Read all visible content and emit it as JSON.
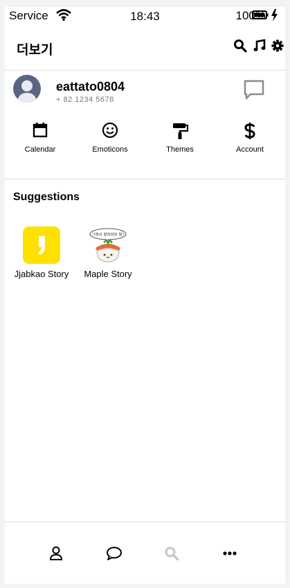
{
  "status_bar": {
    "carrier": "Service",
    "time": "18:43",
    "battery": "100%"
  },
  "header": {
    "title": "더보기"
  },
  "profile": {
    "username": "eattato0804",
    "phone": "+ 82 1234 5678"
  },
  "quick_menu": [
    {
      "label": "Calendar",
      "icon": "calendar-icon"
    },
    {
      "label": "Emoticons",
      "icon": "smile-icon"
    },
    {
      "label": "Themes",
      "icon": "paint-roller-icon"
    },
    {
      "label": "Account",
      "icon": "dollar-icon"
    }
  ],
  "suggestions": {
    "title": "Suggestions",
    "items": [
      {
        "label": "Jjabkao Story",
        "color": "#ffe100"
      },
      {
        "label": "Maple Story"
      }
    ]
  },
  "maple_speech": "그래서 말하려던 말?",
  "nav": {
    "tabs": [
      "person-icon",
      "chat-icon",
      "search-icon",
      "more-icon"
    ],
    "active_color": "#000000",
    "inactive_color": "#c8c8c8"
  },
  "colors": {
    "avatar_bg": "#5a6585",
    "brand_yellow": "#ffe100"
  }
}
